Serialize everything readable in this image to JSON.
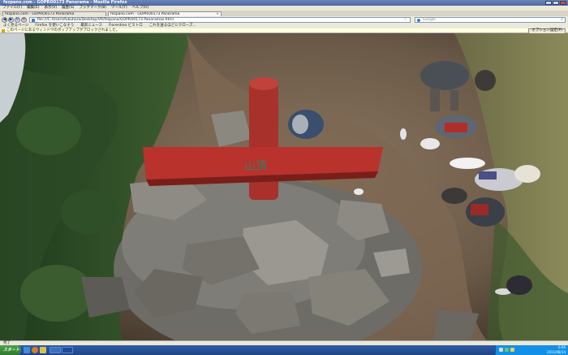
{
  "window": {
    "title": "fezpano.com - GOPRO0173 Panorama - Mozilla Firefox"
  },
  "menu": [
    "ファイル(F)",
    "編集(E)",
    "表示(V)",
    "履歴(S)",
    "ブックマーク(B)",
    "ツール(T)",
    "ヘルプ(H)"
  ],
  "tabs": [
    {
      "label": "fezpano.com - GOPRO0173 Panorama"
    },
    {
      "label": "fezpano.com - GOPRO0173 Panorama"
    }
  ],
  "nav": {
    "url": "file:///C:/Users/fukuhara/Desktop/VR/fezpano/GOPRO0173 Panoramas.html",
    "search_placeholder": "Google"
  },
  "bookmarks": [
    "よく見るページ",
    "Firefox を使いこなそう",
    "最新ニュース",
    "Fiorentino ビストロ",
    "これを送るほどにクローズ..."
  ],
  "notice": {
    "text": "このページにあるウィンドウのポップアップがブロックされました。",
    "button": "オプション設定(P)"
  },
  "status": {
    "text": "完了"
  },
  "taskbar": {
    "start": "スタート",
    "clock_time": "6:06",
    "clock_date": "2011/08/14"
  },
  "scene": {
    "sign_text": "山頂"
  },
  "icons": {
    "back": "back-arrow-icon",
    "forward": "forward-arrow-icon",
    "reload": "reload-icon",
    "stop": "stop-icon",
    "home": "home-icon",
    "search": "search-icon"
  },
  "colors": {
    "title_bar": "#4b6aa4",
    "chrome": "#ece9d8",
    "taskbar": "#1e4483",
    "sign_red": "#b9322b"
  }
}
